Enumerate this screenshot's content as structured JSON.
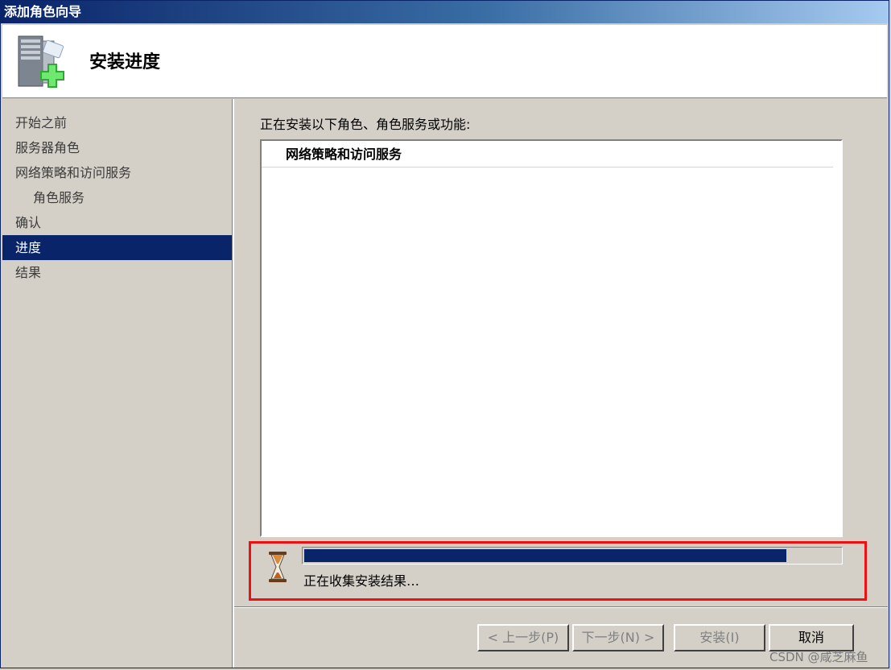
{
  "window": {
    "title": "添加角色向导"
  },
  "header": {
    "title": "安装进度",
    "icon": "server-add-icon"
  },
  "sidebar": {
    "items": [
      {
        "label": "开始之前",
        "active": false,
        "sub": false
      },
      {
        "label": "服务器角色",
        "active": false,
        "sub": false
      },
      {
        "label": "网络策略和访问服务",
        "active": false,
        "sub": false
      },
      {
        "label": "角色服务",
        "active": false,
        "sub": true
      },
      {
        "label": "确认",
        "active": false,
        "sub": false
      },
      {
        "label": "进度",
        "active": true,
        "sub": false
      },
      {
        "label": "结果",
        "active": false,
        "sub": false
      }
    ]
  },
  "main": {
    "label": "正在安装以下角色、角色服务或功能:",
    "list_header": "网络策略和访问服务",
    "progress": {
      "value_percent": 90,
      "status": "正在收集安装结果…"
    }
  },
  "buttons": {
    "back": "< 上一步(P)",
    "next": "下一步(N) >",
    "install": "安装(I)",
    "cancel": "取消"
  },
  "watermark": "CSDN @咸芝麻鱼",
  "colors": {
    "title_bar": "#0a246a",
    "selection": "#0a246a",
    "progress_fill": "#0a246a",
    "highlight_border": "#ee1111"
  }
}
